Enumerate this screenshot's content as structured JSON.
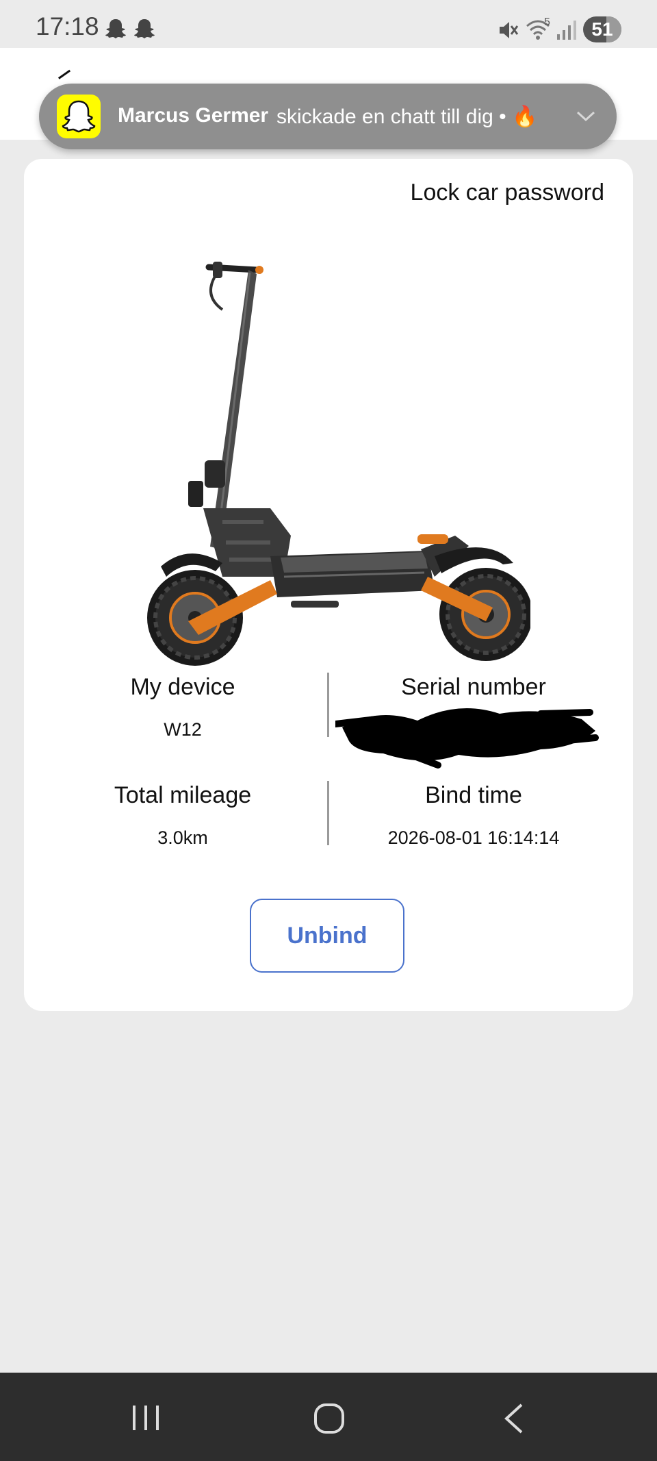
{
  "status_bar": {
    "time": "17:18",
    "notification_icons": [
      "snapchat-ghost-icon",
      "snapchat-ghost-icon"
    ],
    "system_icons": [
      "mute-icon",
      "wifi-icon",
      "signal-icon"
    ],
    "wifi_badge": "5",
    "battery_percent": "51"
  },
  "notification": {
    "app_icon": "snapchat-icon",
    "sender": "Marcus Germer",
    "message": "skickade en chatt till dig • 🔥"
  },
  "card": {
    "lock_password_link": "Lock car password",
    "device_image": "electric-scooter",
    "my_device_label": "My device",
    "my_device_value": "W12",
    "serial_label": "Serial number",
    "serial_value_redacted": true,
    "mileage_label": "Total mileage",
    "mileage_value": "3.0km",
    "bind_time_label": "Bind time",
    "bind_time_value": "2026-08-01 16:14:14",
    "unbind_button": "Unbind"
  },
  "colors": {
    "accent": "#4a72cc",
    "background": "#ebebeb",
    "notification_bg": "#8f8f8f",
    "snapchat_yellow": "#fffc00",
    "scooter_orange": "#e07a1f"
  },
  "nav_bar": {
    "buttons": [
      "recents-icon",
      "home-icon",
      "back-icon"
    ]
  }
}
